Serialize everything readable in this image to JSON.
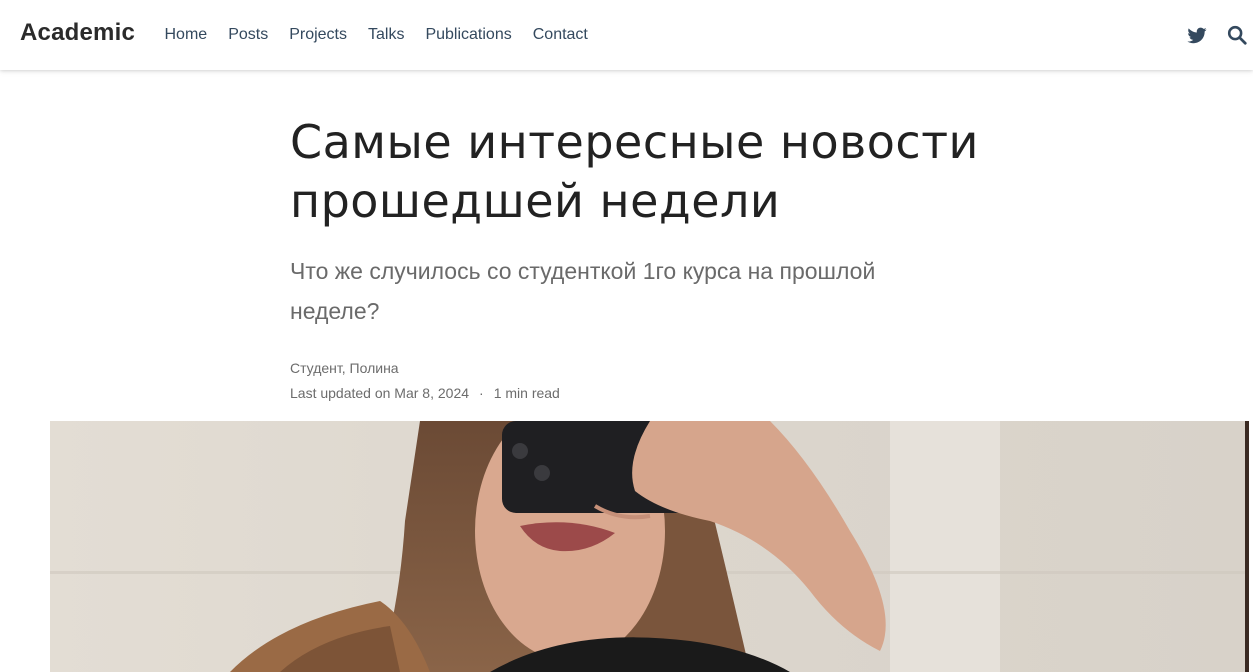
{
  "brand": "Academic",
  "nav": {
    "links": [
      {
        "label": "Home"
      },
      {
        "label": "Posts"
      },
      {
        "label": "Projects"
      },
      {
        "label": "Talks"
      },
      {
        "label": "Publications"
      },
      {
        "label": "Contact"
      }
    ],
    "icons": [
      "twitter-icon",
      "search-icon"
    ]
  },
  "article": {
    "title": "Самые интересные новости прошедшей недели",
    "subtitle": "Что же случилось со студенткой 1го курса на прошлой неделе?",
    "authors": [
      "Студент",
      "Полина"
    ],
    "last_updated": "Last updated on Mar 8, 2024",
    "separator": "·",
    "reading_time": "1 min read"
  },
  "colors": {
    "nav_text": "#34495e",
    "title": "#222222",
    "subtitle": "#6a6a6a",
    "meta": "#6c6c6c"
  }
}
